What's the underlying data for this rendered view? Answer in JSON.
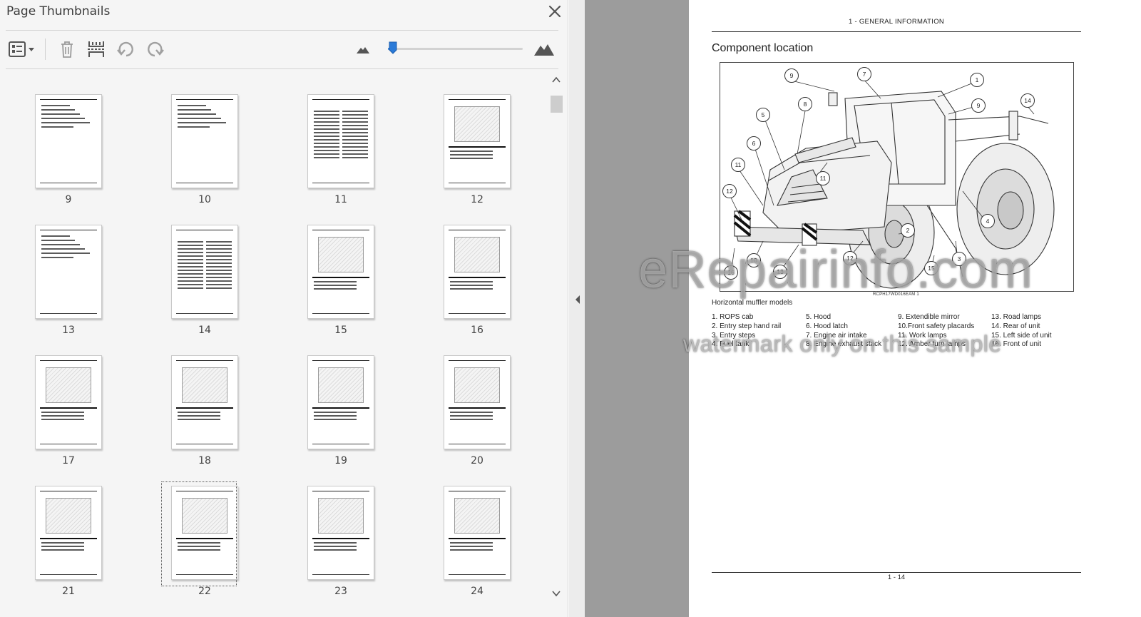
{
  "panel": {
    "title": "Page Thumbnails",
    "toolbar": {
      "options_icon": "thumbnail-options-icon",
      "delete_icon": "trash-icon",
      "insert_icon": "insert-pages-icon",
      "rotate_ccw_icon": "rotate-counterclockwise-icon",
      "rotate_cw_icon": "rotate-clockwise-icon",
      "zoom_out_icon": "small-mountain-icon",
      "zoom_in_icon": "large-mountain-icon",
      "zoom_level": 0.03
    },
    "accent_color": "#2a7ad8",
    "selected_page": "22",
    "pages": [
      "9",
      "10",
      "11",
      "12",
      "13",
      "14",
      "15",
      "16",
      "17",
      "18",
      "19",
      "20",
      "21",
      "22",
      "23",
      "24"
    ]
  },
  "document": {
    "running_head": "1 - GENERAL INFORMATION",
    "section_title": "Component location",
    "figure_code": "RCPH17WD016EAM    1",
    "models_caption": "Horizontal muffler models",
    "callouts": [
      "1",
      "2",
      "3",
      "4",
      "5",
      "6",
      "7",
      "8",
      "9",
      "9",
      "10",
      "11",
      "11",
      "12",
      "12",
      "13",
      "14",
      "15",
      "16"
    ],
    "legend": [
      [
        "1.  ROPS cab",
        "2.  Entry step hand rail",
        "3.  Entry steps",
        "4.  Fuel tank"
      ],
      [
        "5.  Hood",
        "6.  Hood latch",
        "7.  Engine air intake",
        "8.  Engine exhaust stack"
      ],
      [
        "9.  Extendible mirror",
        "10.Front safety placards",
        "11.  Work lamps",
        "12.  Amber turn lamps"
      ],
      [
        "13.  Road lamps",
        "14.  Rear of unit",
        "15.  Left side of unit",
        "16.  Front of unit"
      ]
    ],
    "page_number": "1 - 14"
  },
  "watermark": {
    "line1": "eRepairinfo.com",
    "line2": "watermark only on this sample"
  }
}
